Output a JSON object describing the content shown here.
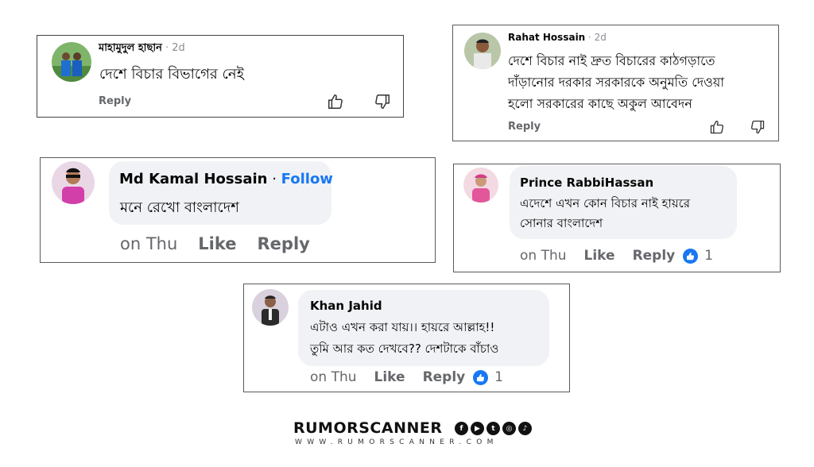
{
  "comments": [
    {
      "name": "মাহামুদুল হাছান",
      "sep": " · ",
      "time": "2d",
      "text": [
        "দেশে  বিচার বিভাগের নেই"
      ],
      "actions": {
        "reply": "Reply"
      },
      "icons": [
        "thumbs-up-outline-icon",
        "thumbs-down-outline-icon"
      ]
    },
    {
      "name": "Rahat Hossain",
      "sep": " · ",
      "time": "2d",
      "text": [
        "দেশে বিচার নাই দ্রুত বিচারের কাঠগড়াতে",
        "দাঁড়ানোর দরকার সরকারকে অনুমতি দেওয়া",
        "হলো সরকারের কাছে অকুল আবেদন"
      ],
      "actions": {
        "reply": "Reply"
      },
      "icons": [
        "thumbs-up-outline-icon",
        "thumbs-down-outline-icon"
      ]
    },
    {
      "name": "Md Kamal Hossain",
      "sep": " · ",
      "follow": "Follow",
      "text": [
        "মনে রেখো বাংলাদেশ"
      ],
      "actions": {
        "time": "on Thu",
        "like": "Like",
        "reply": "Reply"
      }
    },
    {
      "name": "Prince RabbiHassan",
      "text": [
        "এদেশে এখন কোন বিচার নাই হায়রে",
        "সোনার বাংলাদেশ"
      ],
      "actions": {
        "time": "on Thu",
        "like": "Like",
        "reply": "Reply",
        "reactions": "1"
      }
    },
    {
      "name": "Khan Jahid",
      "text": [
        "এটাও এখন করা যায়।। হায়রে আল্লাহ!!",
        "তুমি আর কত দেখবে?? দেশটাকে বাঁচাও"
      ],
      "actions": {
        "time": "on Thu",
        "like": "Like",
        "reply": "Reply",
        "reactions": "1"
      }
    }
  ],
  "logo": {
    "brand": "RUMORSCANNER",
    "url": "WWW.RUMORSCANNER.COM",
    "social_icons": [
      "facebook-icon",
      "youtube-icon",
      "twitter-icon",
      "instagram-icon",
      "tiktok-icon"
    ]
  },
  "colors": {
    "link": "#1877f2",
    "bubble": "#f0f2f5",
    "secondary_text": "#65676b",
    "border": "#5a5a5a"
  }
}
